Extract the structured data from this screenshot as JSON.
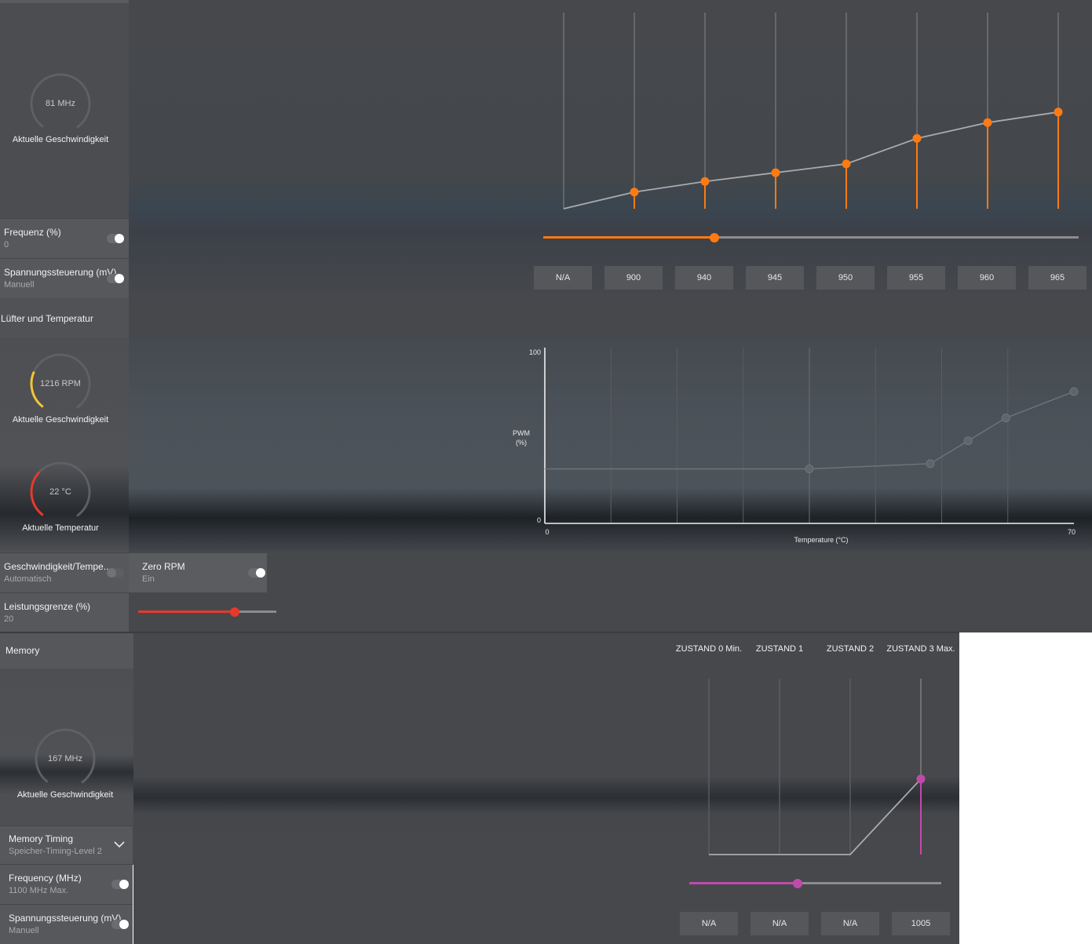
{
  "gpu": {
    "gauge_value": "81 MHz",
    "gauge_label": "Aktuelle Geschwindigkeit",
    "frequency": {
      "title": "Frequenz (%)",
      "value": "0",
      "toggle_on": true
    },
    "voltage": {
      "title": "Spannungssteuerung (mV)",
      "value": "Manuell",
      "toggle_on": true
    },
    "slider_level": 0.32,
    "states": [
      "N/A",
      "900",
      "940",
      "945",
      "950",
      "955",
      "960",
      "965"
    ],
    "curve_levels": [
      0.0,
      0.19,
      0.31,
      0.41,
      0.51,
      0.8,
      0.98,
      1.1
    ]
  },
  "fan": {
    "section_title": "Lüfter und Temperatur",
    "rpm_gauge_value": "1216 RPM",
    "rpm_gauge_label": "Aktuelle Geschwindigkeit",
    "temp_gauge_value": "22 °C",
    "temp_gauge_label": "Aktuelle Temperatur",
    "speed_temp": {
      "title": "Geschwindigkeit/Tempe...",
      "value": "Automatisch",
      "toggle_on": false
    },
    "zero_rpm": {
      "title": "Zero RPM",
      "value": "Ein",
      "toggle_on": true
    },
    "power_limit": {
      "title": "Leistungsgrenze (%)",
      "value": "20"
    },
    "power_slider_level": 0.7,
    "chart": {
      "ylabel": "PWM\n(%)",
      "xlabel": "Temperature (°C)",
      "y_max_label": "100",
      "y_min_label": "0",
      "x_min_label": "0",
      "x_max_label": "70"
    }
  },
  "chart_data": {
    "type": "line",
    "xlabel": "Temperature (°C)",
    "ylabel": "PWM (%)",
    "xlim": [
      0,
      70
    ],
    "ylim": [
      0,
      100
    ],
    "x": [
      0,
      35,
      51,
      56,
      61,
      70
    ],
    "values": [
      31,
      31,
      34,
      47,
      60,
      75
    ]
  },
  "memory": {
    "section_title": "Memory",
    "gauge_value": "167 MHz",
    "gauge_label": "Aktuelle Geschwindigkeit",
    "timing": {
      "title": "Memory Timing",
      "value": "Speicher-Timing-Level 2"
    },
    "frequency": {
      "title": "Frequency (MHz)",
      "value": "1100 MHz Max.",
      "toggle_on": true
    },
    "voltage": {
      "title": "Spannungssteuerung (mV)",
      "value": "Manuell",
      "toggle_on": true
    },
    "state_labels": [
      "ZUSTAND 0 Min.",
      "ZUSTAND 1",
      "ZUSTAND 2",
      "ZUSTAND 3 Max."
    ],
    "states": [
      "N/A",
      "N/A",
      "N/A",
      "1005"
    ],
    "slider_level": 0.43
  },
  "colors": {
    "accent_orange": "#ff7a12",
    "accent_red": "#e8392b",
    "accent_yellow": "#f5c431",
    "accent_magenta": "#c04aa9"
  }
}
